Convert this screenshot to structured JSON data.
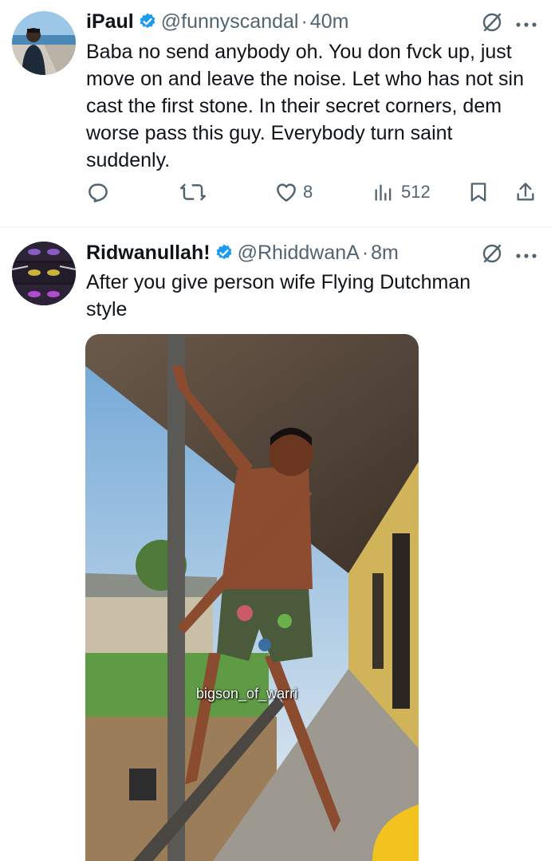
{
  "tweets": [
    {
      "display_name": "iPaul",
      "handle": "@funnyscandal",
      "separator": "·",
      "time": "40m",
      "text": "Baba no send anybody oh. You don fvck up, just move on and leave the noise. Let who has not sin cast the first stone. In their secret corners, dem worse pass this guy. Everybody turn saint suddenly.",
      "likes": "8",
      "views": "512"
    },
    {
      "display_name": "Ridwanullah!",
      "handle": "@RhiddwanA",
      "separator": "·",
      "time": "8m",
      "text": "After you give person wife Flying Dutchman style",
      "media_watermark": "bigson_of_warri"
    }
  ],
  "icons": {
    "verified": "verified-badge-icon",
    "grok": "grok-icon",
    "more": "more-icon",
    "reply": "reply-icon",
    "retweet": "retweet-icon",
    "like": "like-icon",
    "views": "views-icon",
    "bookmark": "bookmark-icon",
    "share": "share-icon"
  },
  "colors": {
    "verified": "#1d9bf0",
    "secondary_text": "#536471",
    "primary_text": "#0f1419"
  }
}
